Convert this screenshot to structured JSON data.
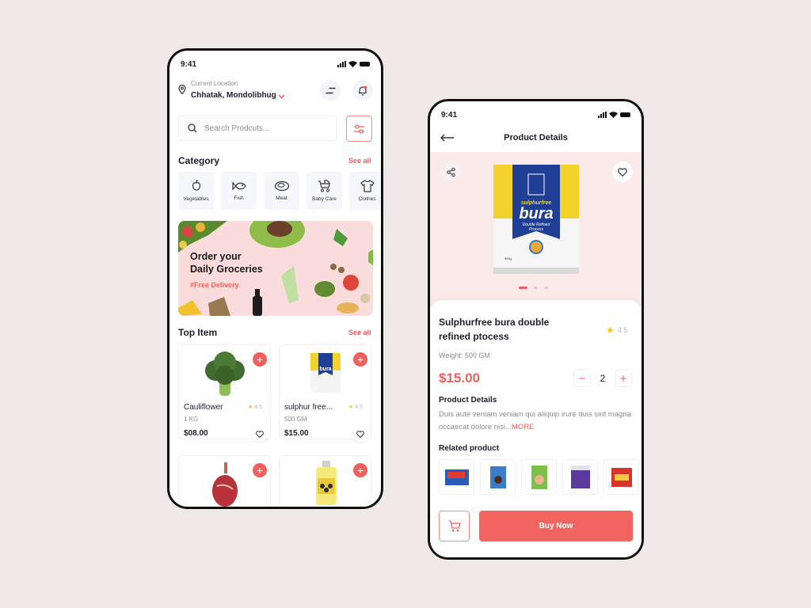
{
  "home": {
    "status_time": "9:41",
    "location_label": "Current Location",
    "location_value": "Chhatak, Mondolibhug",
    "search_placeholder": "Search Prodcuts...",
    "category_title": "Category",
    "category_see_all": "See all",
    "categories": [
      {
        "label": "Vegetables",
        "icon": "pepper-icon"
      },
      {
        "label": "Fish",
        "icon": "fish-icon"
      },
      {
        "label": "Meat",
        "icon": "meat-icon"
      },
      {
        "label": "Baby Care",
        "icon": "stroller-icon"
      },
      {
        "label": "Clothes",
        "icon": "tshirt-icon"
      }
    ],
    "banner": {
      "line1": "Order your",
      "line2": "Daily Groceries",
      "tag": "#Free Delivery"
    },
    "top_title": "Top Item",
    "top_see_all": "See all",
    "items": [
      {
        "name": "Cauliflower",
        "weight": "1 KG",
        "price": "$08.00",
        "rating": "4.5"
      },
      {
        "name": "sulphur free...",
        "weight": "500 GM",
        "price": "$15.00",
        "rating": "4.5"
      },
      {
        "name": "",
        "weight": "",
        "price": "",
        "rating": ""
      },
      {
        "name": "",
        "weight": "",
        "price": "",
        "rating": ""
      }
    ]
  },
  "detail": {
    "status_time": "9:41",
    "title": "Product Details",
    "product_name": "Sulphurfree bura  double refined ptocess",
    "rating": "4.5",
    "weight": "Weight: 500 GM",
    "price": "$15.00",
    "quantity": "2",
    "carousel": {
      "count": 3,
      "active": 1
    },
    "details_title": "Product Details",
    "details_text": "Duis aute veniam veniam qui aliquip irure duis sint magna occaecat dolore nisi...",
    "more_label": "MORE",
    "related_title": "Related product",
    "related_count": 5,
    "buy_label": "Buy Now",
    "bag_text": {
      "brand": "sulphurfree",
      "name": "bura",
      "sub1": "Double Refined",
      "sub2": "Process",
      "weight": "500g"
    }
  },
  "colors": {
    "accent": "#f25f5c",
    "background": "#f1e8ea",
    "star": "#f5c518"
  }
}
